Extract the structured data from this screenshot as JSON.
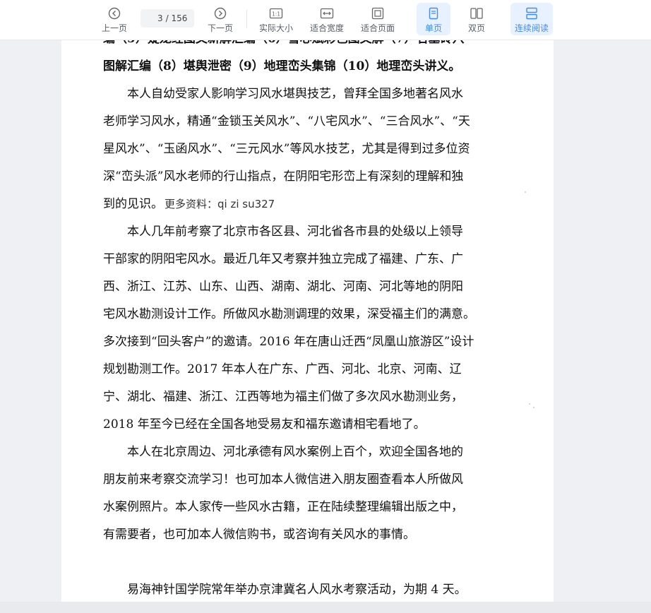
{
  "toolbar": {
    "prev_label": "上一页",
    "page_current": "3",
    "page_total": "/ 156",
    "next_label": "下一页",
    "actual_size_label": "实际大小",
    "fit_width_label": "适合宽度",
    "fit_page_label": "适合页面",
    "single_label": "单页",
    "double_label": "双页",
    "continuous_label": "连续阅读",
    "accent_color": "#3d8bfd"
  },
  "document": {
    "lines": [
      "编（5）疑龙经图文新解汇编（6）雪心赋彩色图文解（7）名墓砖穴",
      "图解汇编（8）堪舆泄密（9）地理峦头集锦（10）地理峦头讲义。",
      "本人自幼受家人影响学习风水堪舆技艺，曾拜全国多地著名风水",
      "老师学习风水，精通“金锁玉关风水”、“八宅风水”、“三合风水”、“天",
      "星风水”、“玉函风水”、“三元风水”等风水技艺，尤其是得到过多位资",
      "深“峦头派”风水老师的行山指点，在阴阳宅形峦上有深刻的理解和独",
      "到的见识。",
      "本人几年前考察了北京市各区县、河北省各市县的处级以上领导",
      "干部家的阴阳宅风水。最近几年又考察并独立完成了福建、广东、广",
      "西、浙江、江苏、山东、山西、湖南、湖北、河南、河北等地的阴阳",
      "宅风水勘测设计工作。所做风水勘测调理的效果，深受福主们的满意。",
      "多次接到“回头客户”的邀请。2016 年在唐山迁西“凤凰山旅游区”设计",
      "规划勘测工作。2017 年本人在广东、广西、河北、北京、河南、辽",
      "宁、湖北、福建、浙江、江西等地为福主们做了多次风水勘测业务，",
      "2018 年至今已经在全国各地受易友和福东邀请相宅看地了。",
      "本人在北京周边、河北承德有风水案例上百个，欢迎全国各地的",
      "朋友前来考察交流学习！也可加本人微信进入朋友圈查看本人所做风",
      "水案例照片。本人家传一些风水古籍，正在陆续整理编辑出版之中，",
      "有需要者，也可加本人微信购书，或咨询有关风水的事情。",
      "易海神针国学院常年举办京津冀名人风水考察活动，为期 4 天。"
    ],
    "inline_note": "更多资料：qi zi su327"
  }
}
